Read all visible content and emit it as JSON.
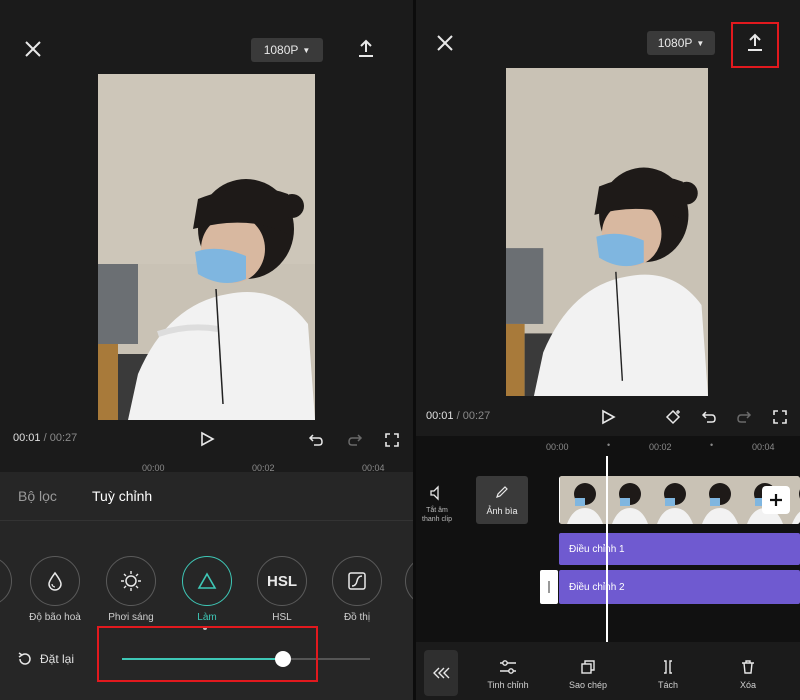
{
  "left": {
    "resolution": "1080P",
    "time_current": "00:01",
    "time_total": "/ 00:27",
    "ruler": [
      "00:00",
      "00:02",
      "00:04"
    ],
    "tabs": [
      "Bộ lọc",
      "Tuỳ chỉnh"
    ],
    "tools": [
      {
        "label": "Độ bão hoà",
        "icon": "drop-icon"
      },
      {
        "label": "Phơi sáng",
        "icon": "exposure-icon"
      },
      {
        "label": "Làm",
        "icon": "triangle-icon"
      },
      {
        "label": "HSL",
        "icon": "hsl-icon"
      },
      {
        "label": "Đồ thị",
        "icon": "curve-icon"
      }
    ],
    "hsl_text": "HSL",
    "reset_label": "Đặt lại",
    "slider_value": 0.65,
    "accent": "#3ec7b6"
  },
  "right": {
    "resolution": "1080P",
    "time_current": "00:01",
    "time_total": "/ 00:27",
    "ruler": [
      "00:00",
      "00:02",
      "00:04"
    ],
    "mute_label": "Tắt âm thanh clip",
    "cover_label": "Ảnh bìa",
    "clip1": "Điều chỉnh 1",
    "clip2": "Điều chỉnh 2",
    "bottom_tools": [
      "Tinh chỉnh",
      "Sao chép",
      "Tách",
      "Xóa"
    ],
    "clip_color": "#6f5ad0"
  },
  "highlight_color": "#e2191e"
}
